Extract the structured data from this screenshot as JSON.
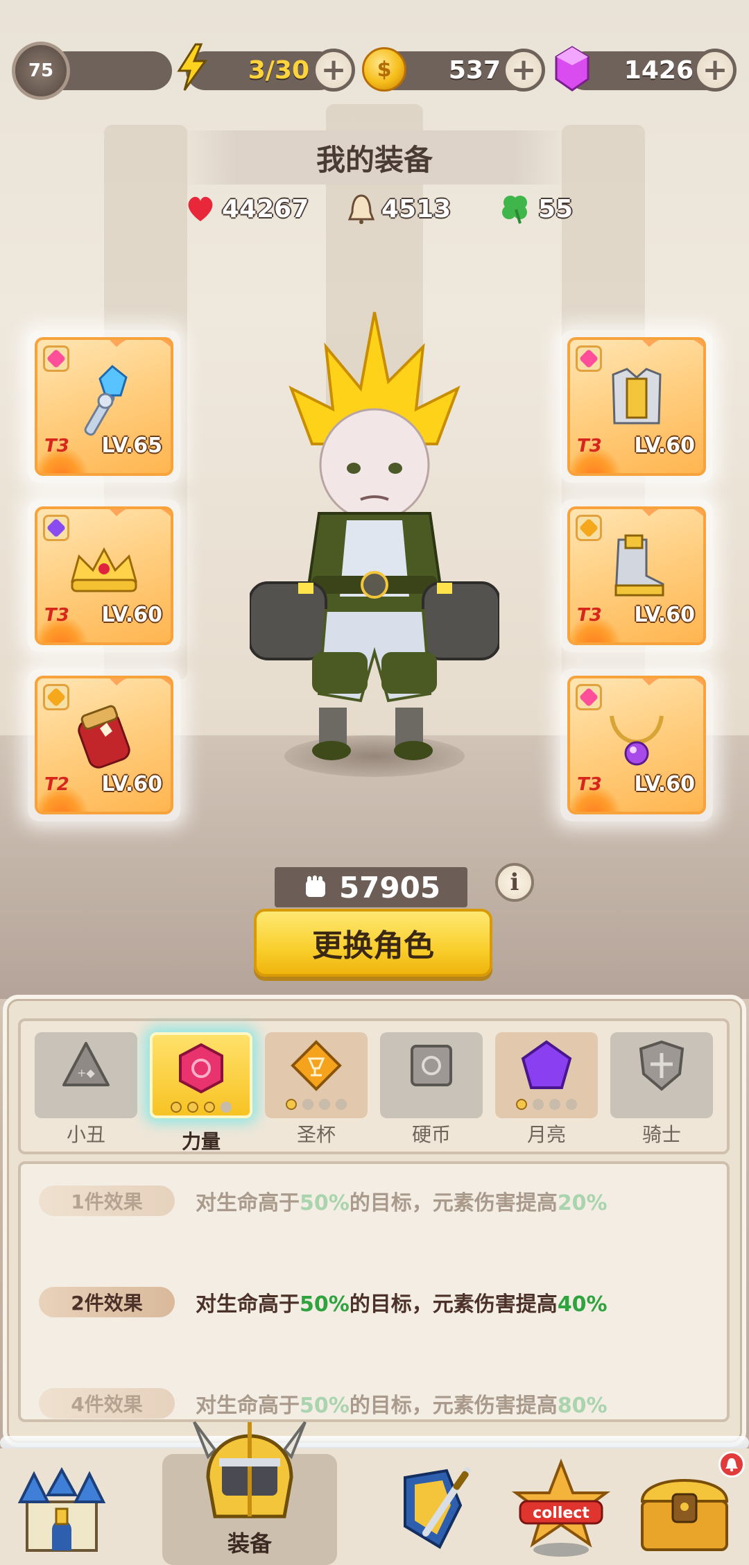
{
  "topbar": {
    "level": "75",
    "energy": "3/30",
    "coins": "537",
    "gems": "1426"
  },
  "header": {
    "title": "我的装备",
    "hp": "44267",
    "attack": "4513",
    "luck": "55"
  },
  "equipment": {
    "left": [
      {
        "tier": "T3",
        "level": "LV.65",
        "gem_color": "#ff4f9a"
      },
      {
        "tier": "T3",
        "level": "LV.60",
        "gem_color": "#8a4cf0"
      },
      {
        "tier": "T2",
        "level": "LV.60",
        "gem_color": "#f6a81c"
      }
    ],
    "right": [
      {
        "tier": "T3",
        "level": "LV.60",
        "gem_color": "#ff4f9a"
      },
      {
        "tier": "T3",
        "level": "LV.60",
        "gem_color": "#f6a81c"
      },
      {
        "tier": "T3",
        "level": "LV.60",
        "gem_color": "#ff4f9a"
      }
    ]
  },
  "power": "57905",
  "change_character_label": "更换角色",
  "set_tabs": [
    {
      "label": "小丑",
      "icon": "clown-gem-icon"
    },
    {
      "label": "力量",
      "icon": "strength-gem-icon",
      "dots_filled": 3,
      "dots_total": 4
    },
    {
      "label": "圣杯",
      "icon": "grail-gem-icon",
      "dots_filled": 1,
      "dots_total": 4
    },
    {
      "label": "硬币",
      "icon": "coin-gem-icon"
    },
    {
      "label": "月亮",
      "icon": "moon-gem-icon",
      "dots_filled": 1,
      "dots_total": 4
    },
    {
      "label": "骑士",
      "icon": "knight-gem-icon"
    }
  ],
  "effects": [
    {
      "tag": "1件效果",
      "pre": "对生命高于",
      "v1": "50%",
      "mid": "的目标，元素伤害提高",
      "v2": "20%"
    },
    {
      "tag": "2件效果",
      "pre": "对生命高于",
      "v1": "50%",
      "mid": "的目标，元素伤害提高",
      "v2": "40%"
    },
    {
      "tag": "4件效果",
      "pre": "对生命高于",
      "v1": "50%",
      "mid": "的目标，元素伤害提高",
      "v2": "80%"
    }
  ],
  "nav": {
    "active_label": "装备",
    "collect_label": "collect"
  },
  "colors": {
    "accent_yellow": "#f9cf2d",
    "highlight_green": "#2ea33e",
    "panel_bg": "#ece2d2"
  }
}
